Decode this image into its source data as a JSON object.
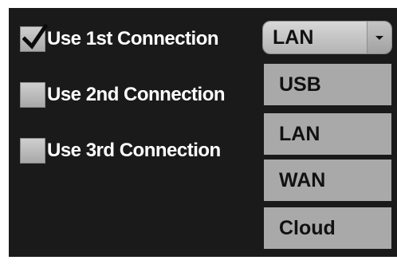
{
  "connections": [
    {
      "label": "Use 1st Connection",
      "checked": true
    },
    {
      "label": "Use 2nd Connection",
      "checked": false
    },
    {
      "label": "Use 3rd Connection",
      "checked": false
    }
  ],
  "connection_type": {
    "selected": "LAN",
    "options": [
      "USB",
      "LAN",
      "WAN",
      "Cloud"
    ]
  },
  "colors": {
    "background": "#1a1a1a",
    "text": "#ffffff",
    "option_background": "#a9a9a9"
  }
}
